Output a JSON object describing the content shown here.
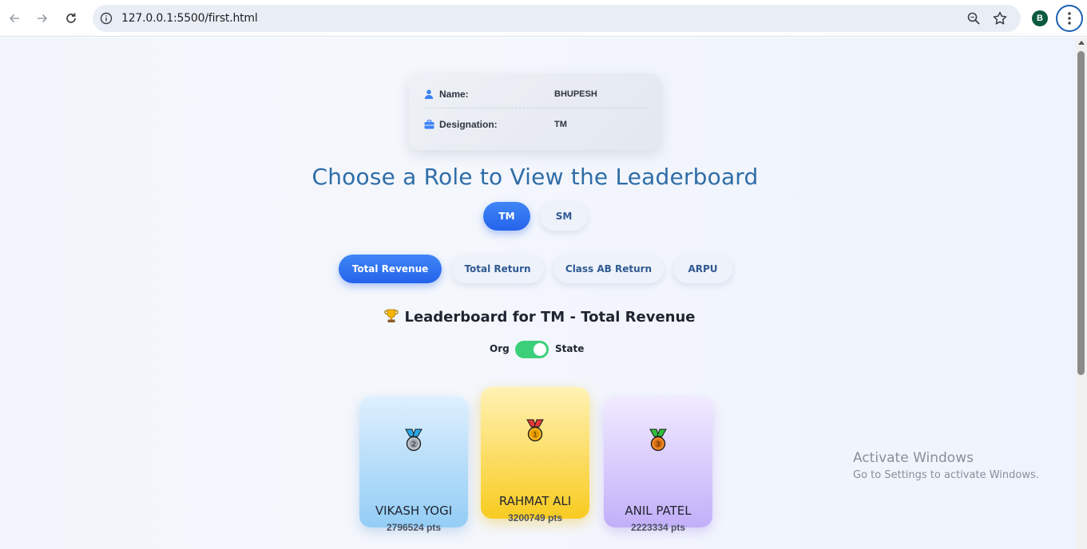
{
  "browser": {
    "url": "127.0.0.1:5500/first.html",
    "profile_initial": "B"
  },
  "profile": {
    "name_label": "Name:",
    "name_value": "BHUPESH",
    "designation_label": "Designation:",
    "designation_value": "TM"
  },
  "page_title": "Choose a Role to View the Leaderboard",
  "roles": [
    {
      "label": "TM",
      "active": true
    },
    {
      "label": "SM",
      "active": false
    }
  ],
  "metrics": [
    {
      "label": "Total Revenue",
      "active": true
    },
    {
      "label": "Total Return",
      "active": false
    },
    {
      "label": "Class AB Return",
      "active": false
    },
    {
      "label": "ARPU",
      "active": false
    }
  ],
  "leaderboard": {
    "title": "Leaderboard for TM - Total Revenue",
    "toggle_left": "Org",
    "toggle_right": "State",
    "toggle_on": true,
    "toggle_color": "#3ccf7a",
    "top3": [
      {
        "rank": 2,
        "name": "VIKASH YOGI",
        "points": "2796524 pts",
        "medal_color": "#2aa8e6"
      },
      {
        "rank": 1,
        "name": "RAHMAT ALI",
        "points": "3200749 pts",
        "medal_color": "#e03a3a"
      },
      {
        "rank": 3,
        "name": "ANIL PATEL",
        "points": "2223334 pts",
        "medal_color": "#2fbf3a"
      }
    ]
  },
  "accent_color": "#2563eb",
  "watermark": {
    "line1": "Activate Windows",
    "line2": "Go to Settings to activate Windows."
  }
}
